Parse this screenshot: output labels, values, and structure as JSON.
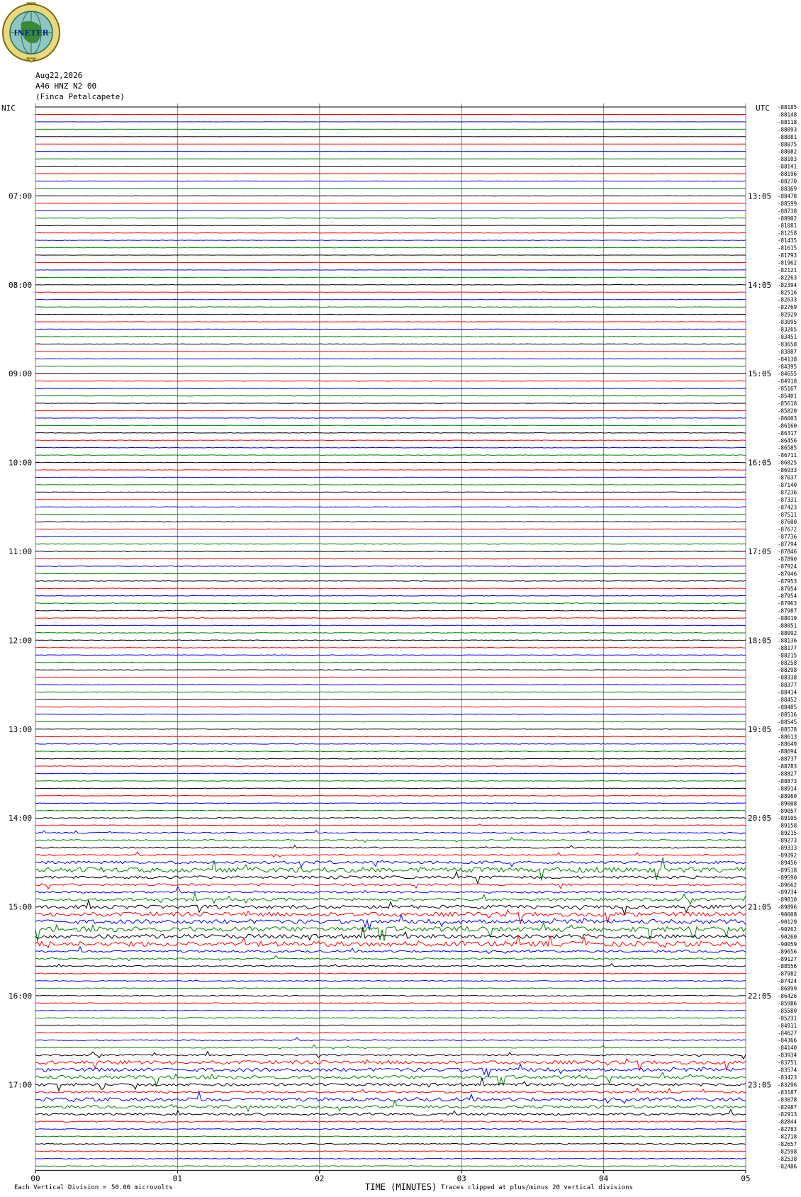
{
  "header": {
    "logo_text": "INETER",
    "date": "Aug22,2026",
    "channel": "A46 HNZ N2 00",
    "station": "(Finca Petalcapete)"
  },
  "tz_left": "NIC",
  "tz_right": "UTC",
  "footer": {
    "scale_prefix": "Each Vertical Division =",
    "scale_value": "50.00 microvolts",
    "x_title": "TIME (MINUTES)",
    "clip_note": "Traces clipped at plus/minus 20 vertical divisions"
  },
  "colors": {
    "trace_cycle": [
      "#000000",
      "#ff0000",
      "#0000ff",
      "#008000"
    ],
    "grid": "#808080"
  },
  "chart_data": {
    "type": "line",
    "title": "",
    "xlabel": "TIME (MINUTES)",
    "x_ticks": [
      "00",
      "01",
      "02",
      "03",
      "04",
      "05"
    ],
    "xlim": [
      0,
      5
    ],
    "trace_count": 144,
    "minutes_per_trace": 5,
    "left_hour_labels": [
      "07:00",
      "08:00",
      "09:00",
      "10:00",
      "11:00",
      "12:00",
      "13:00",
      "14:00",
      "15:00",
      "16:00",
      "17:00"
    ],
    "right_hour_labels": [
      "13:05",
      "14:05",
      "15:05",
      "16:05",
      "17:05",
      "18:05",
      "19:05",
      "20:05",
      "21:05",
      "22:05",
      "23:05"
    ],
    "first_hour_label_trace": 12,
    "trace_offsets": [
      "-88185",
      "-88148",
      "-88118",
      "-88093",
      "-88081",
      "-88075",
      "-88082",
      "-88103",
      "-88141",
      "-88196",
      "-88270",
      "-88369",
      "-88478",
      "-88599",
      "-88738",
      "-88902",
      "-81081",
      "-81258",
      "-81435",
      "-81615",
      "-81793",
      "-81962",
      "-82121",
      "-82263",
      "-82394",
      "-82516",
      "-82633",
      "-82769",
      "-82929",
      "-83095",
      "-83265",
      "-83451",
      "-83658",
      "-83887",
      "-84138",
      "-84395",
      "-84655",
      "-84918",
      "-85167",
      "-85401",
      "-85618",
      "-85820",
      "-86003",
      "-86160",
      "-86317",
      "-86456",
      "-86585",
      "-86711",
      "-86825",
      "-86933",
      "-87037",
      "-87140",
      "-87236",
      "-87331",
      "-87423",
      "-87511",
      "-87600",
      "-87672",
      "-87736",
      "-87794",
      "-87846",
      "-87890",
      "-87924",
      "-87946",
      "-87953",
      "-87954",
      "-87954",
      "-87963",
      "-87987",
      "-88019",
      "-88051",
      "-88092",
      "-88136",
      "-88177",
      "-88215",
      "-88258",
      "-88298",
      "-88338",
      "-88377",
      "-88414",
      "-88452",
      "-88485",
      "-88516",
      "-88545",
      "-88578",
      "-88613",
      "-88649",
      "-88694",
      "-88737",
      "-88783",
      "-88827",
      "-88873",
      "-88914",
      "-88960",
      "-89008",
      "-89057",
      "-89105",
      "-89158",
      "-89215",
      "-89273",
      "-89333",
      "-89392",
      "-89456",
      "-89518",
      "-89590",
      "-89662",
      "-89734",
      "-89810",
      "-89896",
      "-90008",
      "-90129",
      "-90262",
      "-90260",
      "-90059",
      "-89656",
      "-89127",
      "-88556",
      "-87982",
      "-87424",
      "-86899",
      "-86426",
      "-85986",
      "-85580",
      "-85231",
      "-84911",
      "-84627",
      "-84366",
      "-84140",
      "-83934",
      "-83751",
      "-83574",
      "-83423",
      "-83296",
      "-83187",
      "-83078",
      "-82987",
      "-82913",
      "-82844",
      "-82783",
      "-82718",
      "-82657",
      "-82598",
      "-82538",
      "-82486"
    ],
    "series": [
      {
        "values": [
          0.05,
          0.05,
          0.1,
          0.1,
          0.05,
          0.05,
          0.05,
          0.05,
          0.2,
          0.2,
          0.25,
          0.25,
          0.25,
          0.2,
          0.25,
          0.3,
          0.3,
          0.3,
          0.3,
          0.2,
          0.2,
          0.2,
          0.2,
          0.2,
          0.25,
          0.2,
          0.2,
          0.3,
          0.3,
          0.3,
          0.3,
          0.3,
          0.3,
          0.3,
          0.3,
          0.3,
          0.3,
          0.3,
          0.3,
          0.3,
          0.3,
          0.3,
          0.3,
          0.3,
          0.3,
          0.3,
          0.3,
          0.3,
          0.3,
          0.3,
          0.3,
          0.3,
          0.3,
          0.3,
          0.3,
          0.3,
          0.4,
          0.4,
          0.4,
          0.4,
          0.4,
          0.4,
          0.4,
          0.4,
          0.4,
          0.4,
          0.4,
          0.4,
          0.4,
          0.4,
          0.4,
          0.4,
          0.4,
          0.4,
          0.4,
          0.4,
          0.4,
          0.4,
          0.4,
          0.4,
          0.4,
          0.4,
          0.4,
          0.4,
          0.4,
          0.4,
          0.4,
          0.4,
          0.4,
          0.4,
          0.4,
          0.4,
          0.4,
          0.4,
          0.4,
          0.4,
          0.6,
          0.8,
          0.8,
          0.9,
          0.9,
          1.0,
          2.0,
          3.5,
          2.0,
          1.5,
          1.5,
          2.0,
          2.5,
          3.0,
          3.0,
          3.5,
          3.0,
          3.5,
          1.5,
          1.0,
          0.8,
          0.6,
          0.6,
          0.6,
          0.6,
          0.6,
          0.6,
          0.6,
          0.6,
          0.6,
          0.8,
          0.8,
          1.2,
          2.5,
          2.5,
          2.5,
          2.0,
          1.5,
          2.5,
          2.0,
          1.5,
          0.8,
          0.6,
          0.6,
          0.6,
          0.6,
          0.6,
          0.6,
          0.6,
          0.6,
          0.6,
          0.6
        ]
      }
    ]
  }
}
